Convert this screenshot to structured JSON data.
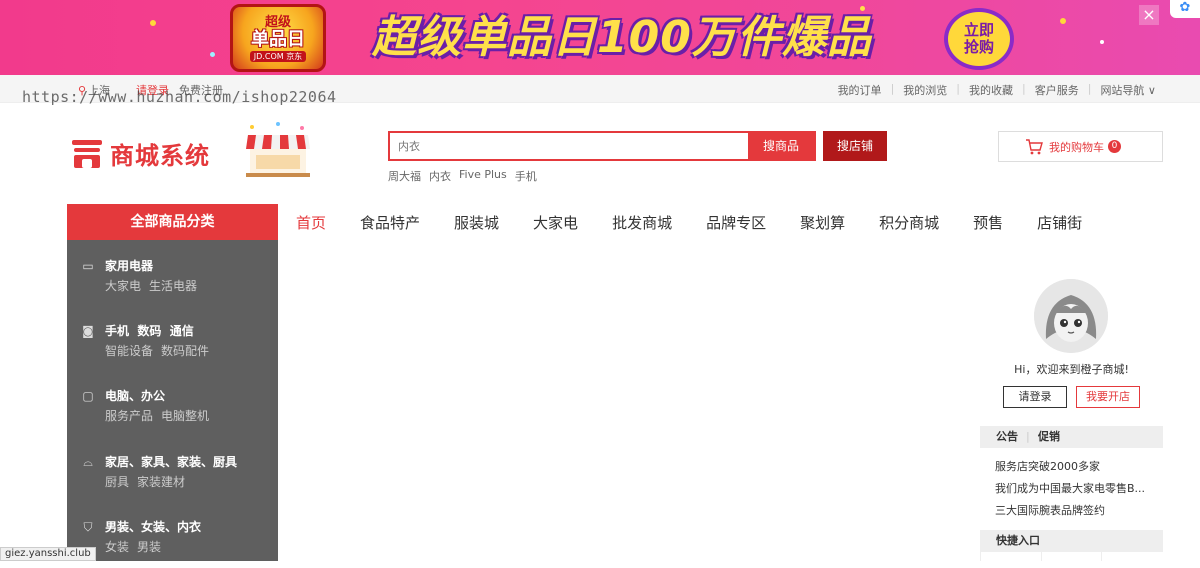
{
  "banner": {
    "badge_line1": "超级",
    "badge_line2": "单品日",
    "badge_line3": "JD.COM 京东",
    "headline": "超级单品日100万件爆品",
    "cta_line1": "立即",
    "cta_line2": "抢购",
    "close_glyph": "×",
    "corner_glyph": "✿"
  },
  "topbar": {
    "location": "上海",
    "login": "请登录",
    "register": "免费注册",
    "links": [
      "我的订单",
      "我的浏览",
      "我的收藏",
      "客户服务",
      "网站导航 ∨"
    ],
    "watermark": "https://www.huzhan.com/ishop22064"
  },
  "header": {
    "logo_text": "商城系统",
    "search_placeholder": "内衣",
    "search_goods_button": "搜商品",
    "search_shop_button": "搜店铺",
    "hotwords": [
      "周大福",
      "内衣",
      "Five Plus",
      "手机"
    ],
    "cart_label": "我的购物车",
    "cart_count": "0"
  },
  "category": {
    "title": "全部商品分类",
    "items": [
      {
        "icon": "tv-icon",
        "title": "家用电器",
        "subs": [
          "大家电",
          "生活电器"
        ]
      },
      {
        "icon": "camera-icon",
        "title": "手机  数码  通信",
        "subs": [
          "智能设备",
          "数码配件"
        ]
      },
      {
        "icon": "monitor-icon",
        "title": "电脑、办公",
        "subs": [
          "服务产品",
          "电脑整机"
        ]
      },
      {
        "icon": "sofa-icon",
        "title": "家居、家具、家装、厨具",
        "subs": [
          "厨具",
          "家装建材"
        ]
      },
      {
        "icon": "shirt-icon",
        "title": "男装、女装、内衣",
        "subs": [
          "女装",
          "男装"
        ]
      }
    ]
  },
  "nav": {
    "items": [
      "首页",
      "食品特产",
      "服装城",
      "大家电",
      "批发商城",
      "品牌专区",
      "聚划算",
      "积分商城",
      "预售",
      "店铺街"
    ]
  },
  "user_panel": {
    "welcome": "Hi，欢迎来到橙子商城!",
    "login_button": "请登录",
    "open_shop_button": "我要开店",
    "notice_tab": "公告",
    "promo_tab": "促销",
    "notices": [
      "服务店突破2000多家",
      "我们成为中国最大家电零售B...",
      "三大国际腕表品牌签约"
    ],
    "quick_entry": "快捷入口"
  },
  "status_url": "giez.yansshi.club",
  "colors": {
    "brand_red": "#e4393c",
    "dark_red": "#b1191a",
    "sidebar_gray": "#5f5f5f"
  }
}
